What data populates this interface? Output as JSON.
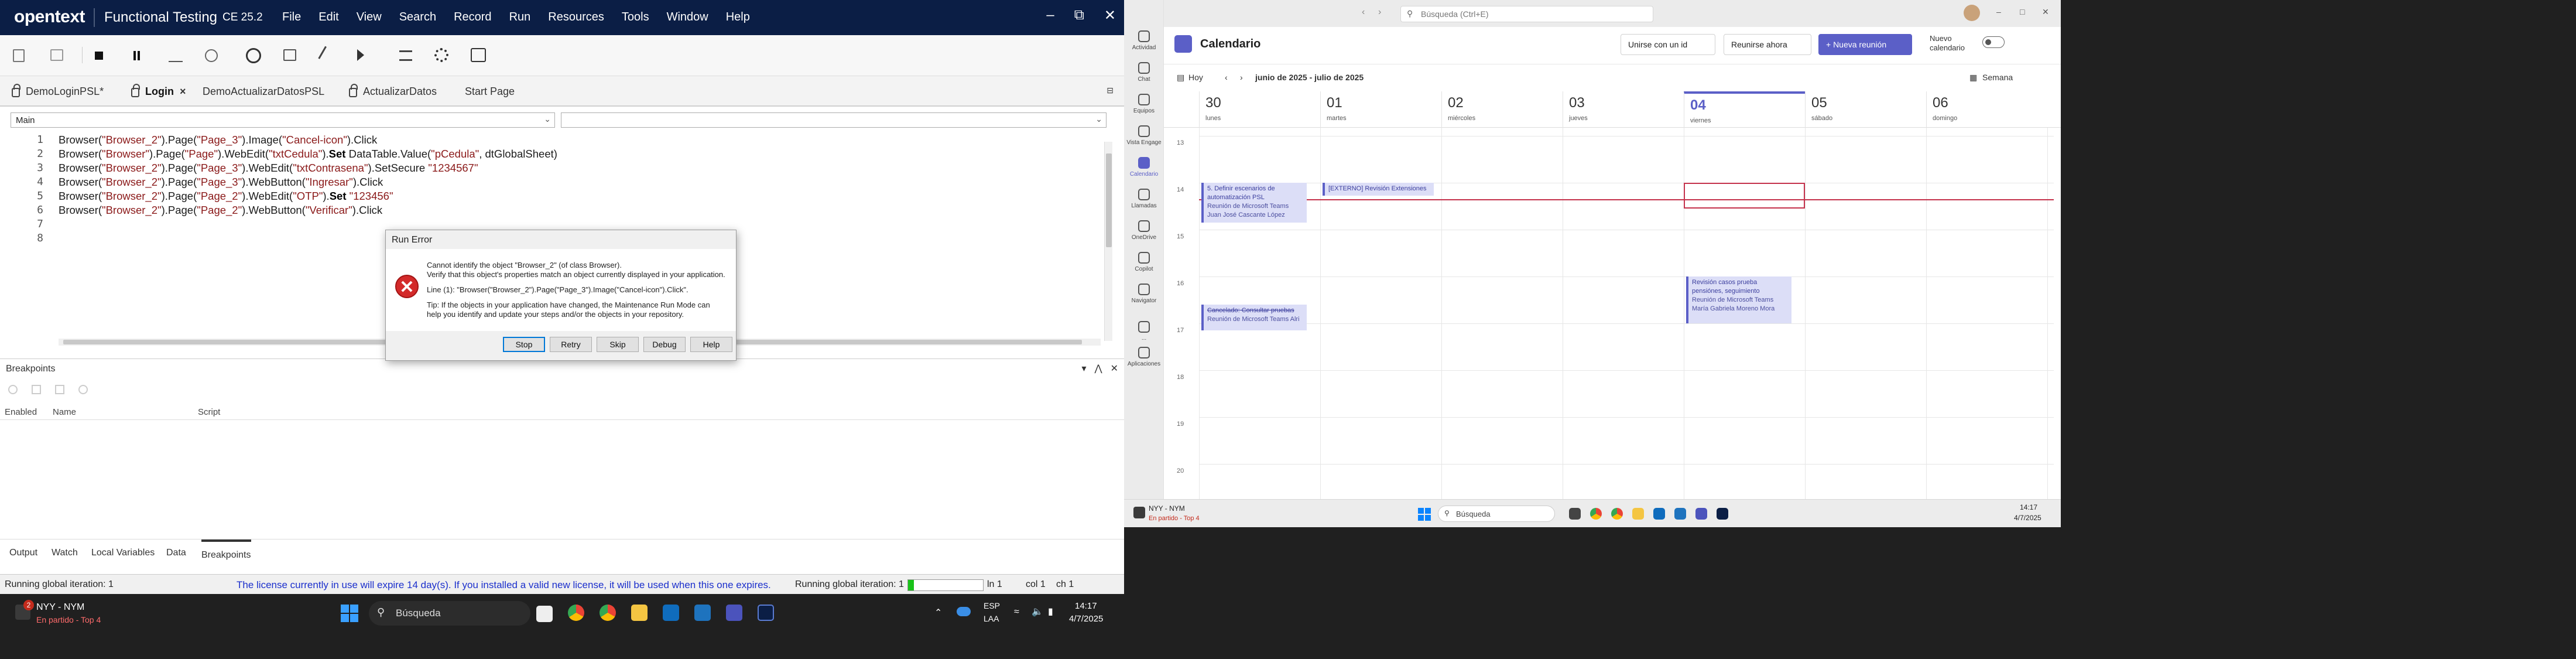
{
  "uft": {
    "logo": "opentext",
    "app_name": "Functional Testing",
    "version": "CE 25.2",
    "menus": [
      "File",
      "Edit",
      "View",
      "Search",
      "Record",
      "Run",
      "Resources",
      "Tools",
      "Window",
      "Help"
    ],
    "window_controls": {
      "minimize": "–",
      "restore": "⧉",
      "close": "✕"
    },
    "doc_tabs": [
      {
        "label": "DemoLoginPSL*",
        "locked": true,
        "active": false
      },
      {
        "label": "Login",
        "locked": true,
        "active": true,
        "close": "×"
      },
      {
        "label": "DemoActualizarDatosPSL",
        "locked": false,
        "active": false
      },
      {
        "label": "ActualizarDatos",
        "locked": true,
        "active": false
      },
      {
        "label": "Start Page",
        "locked": false,
        "active": false
      }
    ],
    "action_combo": "Main",
    "code_lines": [
      {
        "n": "1",
        "segs": [
          [
            "Browser(",
            ""
          ],
          [
            "\"Browser_2\"",
            "s"
          ],
          [
            ").Page(",
            ""
          ],
          [
            "\"Page_3\"",
            "s"
          ],
          [
            ").Image(",
            ""
          ],
          [
            "\"Cancel-icon\"",
            "s"
          ],
          [
            ").Click",
            ""
          ]
        ]
      },
      {
        "n": "2",
        "segs": [
          [
            "Browser(",
            ""
          ],
          [
            "\"Browser\"",
            "s"
          ],
          [
            ").Page(",
            ""
          ],
          [
            "\"Page\"",
            "s"
          ],
          [
            ").WebEdit(",
            ""
          ],
          [
            "\"txtCedula\"",
            "s"
          ],
          [
            ").",
            ""
          ],
          [
            "Set",
            "k"
          ],
          [
            " DataTable.Value(",
            ""
          ],
          [
            "\"pCedula\"",
            "s"
          ],
          [
            ", dtGlobalSheet)",
            ""
          ]
        ]
      },
      {
        "n": "3",
        "segs": [
          [
            "Browser(",
            ""
          ],
          [
            "\"Browser_2\"",
            "s"
          ],
          [
            ").Page(",
            ""
          ],
          [
            "\"Page_3\"",
            "s"
          ],
          [
            ").WebEdit(",
            ""
          ],
          [
            "\"txtContrasena\"",
            "s"
          ],
          [
            ").SetSecure ",
            ""
          ],
          [
            "\"1234567\"",
            "s"
          ]
        ]
      },
      {
        "n": "4",
        "segs": [
          [
            "Browser(",
            ""
          ],
          [
            "\"Browser_2\"",
            "s"
          ],
          [
            ").Page(",
            ""
          ],
          [
            "\"Page_3\"",
            "s"
          ],
          [
            ").WebButton(",
            ""
          ],
          [
            "\"Ingresar\"",
            "s"
          ],
          [
            ").Click",
            ""
          ]
        ]
      },
      {
        "n": "5",
        "segs": [
          [
            "Browser(",
            ""
          ],
          [
            "\"Browser_2\"",
            "s"
          ],
          [
            ").Page(",
            ""
          ],
          [
            "\"Page_2\"",
            "s"
          ],
          [
            ").WebEdit(",
            ""
          ],
          [
            "\"OTP\"",
            "s"
          ],
          [
            ").",
            ""
          ],
          [
            "Set",
            "k"
          ],
          [
            " ",
            ""
          ],
          [
            "\"123456\"",
            "s"
          ]
        ]
      },
      {
        "n": "6",
        "segs": [
          [
            "Browser(",
            ""
          ],
          [
            "\"Browser_2\"",
            "s"
          ],
          [
            ").Page(",
            ""
          ],
          [
            "\"Page_2\"",
            "s"
          ],
          [
            ").WebButton(",
            ""
          ],
          [
            "\"Verificar\"",
            "s"
          ],
          [
            ").Click",
            ""
          ]
        ]
      },
      {
        "n": "7",
        "segs": []
      },
      {
        "n": "8",
        "segs": []
      }
    ],
    "breakpoints": {
      "title": "Breakpoints",
      "columns": [
        "Enabled",
        "Name",
        "Script"
      ]
    },
    "bottom_tabs": [
      "Output",
      "Watch",
      "Local Variables",
      "Data",
      "Breakpoints"
    ],
    "status": {
      "left": "Running global iteration: 1",
      "license": "The license currently in use will expire 14 day(s). If you installed a valid new license, it will be used when this one expires.",
      "iteration": "Running global iteration: 1",
      "ln": "ln 1",
      "col": "col 1",
      "ch": "ch 1",
      "progress": 0.08
    },
    "dialog": {
      "title": "Run Error",
      "lines": [
        "Cannot identify the object \"Browser_2\" (of class Browser).",
        "Verify that this object's properties match an object currently displayed in your application.",
        "Line (1): \"Browser(\"Browser_2\").Page(\"Page_3\").Image(\"Cancel-icon\").Click\".",
        "Tip: If the objects in your application have changed, the Maintenance Run Mode can",
        "help you identify and update your steps and/or the objects in your repository."
      ],
      "buttons": [
        "Stop",
        "Retry",
        "Skip",
        "Debug",
        "Help"
      ]
    }
  },
  "left_taskbar": {
    "weather_title": "NYY - NYM",
    "weather_sub": "En partido - Top 4",
    "badge": "2",
    "search": "Búsqueda",
    "lang1": "ESP",
    "lang2": "LAA",
    "time": "14:17",
    "date": "4/7/2025"
  },
  "teams": {
    "search_placeholder": "Búsqueda (Ctrl+E)",
    "rail": [
      "Actividad",
      "Chat",
      "Equipos",
      "Vista Engage",
      "Calendario",
      "Llamadas",
      "OneDrive",
      "Copilot",
      "Navigator",
      "...",
      "Aplicaciones"
    ],
    "title": "Calendario",
    "join_id": "Unirse con un id",
    "meet_now": "Reunirse ahora",
    "new_meeting": "+ Nueva reunión",
    "new_calendar": "Nuevo calendario",
    "today": "Hoy",
    "range": "junio de 2025 - julio de 2025",
    "view": "Semana",
    "days": [
      {
        "num": "30",
        "name": "lunes"
      },
      {
        "num": "01",
        "name": "martes"
      },
      {
        "num": "02",
        "name": "miércoles"
      },
      {
        "num": "03",
        "name": "jueves"
      },
      {
        "num": "04",
        "name": "viernes",
        "today": true
      },
      {
        "num": "05",
        "name": "sábado"
      },
      {
        "num": "06",
        "name": "domingo"
      }
    ],
    "hours": [
      "13",
      "14",
      "15",
      "16",
      "17",
      "18",
      "19",
      "20"
    ],
    "events": [
      {
        "day": 0,
        "title": "5. Definir escenarios de automatización PSL",
        "sub1": "Reunión de Microsoft Teams",
        "sub2": "Juan José Cascante López"
      },
      {
        "day": 1,
        "title": "[EXTERNO] Revisión Extensiones",
        "sub1": "",
        "sub2": ""
      },
      {
        "day": 0,
        "title": "Cancelado: Consultar pruebas",
        "sub1": "Reunión de Microsoft Teams  Alri",
        "sub2": "",
        "declined": true
      },
      {
        "day": 4,
        "title": "Revisión casos prueba pensiónes, seguimiento",
        "sub1": "Reunión de Microsoft Teams",
        "sub2": "María Gabriela Moreno Mora"
      }
    ],
    "taskbar": {
      "weather_title": "NYY - NYM",
      "weather_sub": "En partido - Top 4",
      "search": "Búsqueda",
      "time": "14:17",
      "date": "4/7/2025"
    }
  },
  "colors": {
    "uft_titlebar": "#0b1e45",
    "teams_accent": "#5b5fc7",
    "now_line": "#c4314b",
    "license_text": "#1b2fcc"
  }
}
